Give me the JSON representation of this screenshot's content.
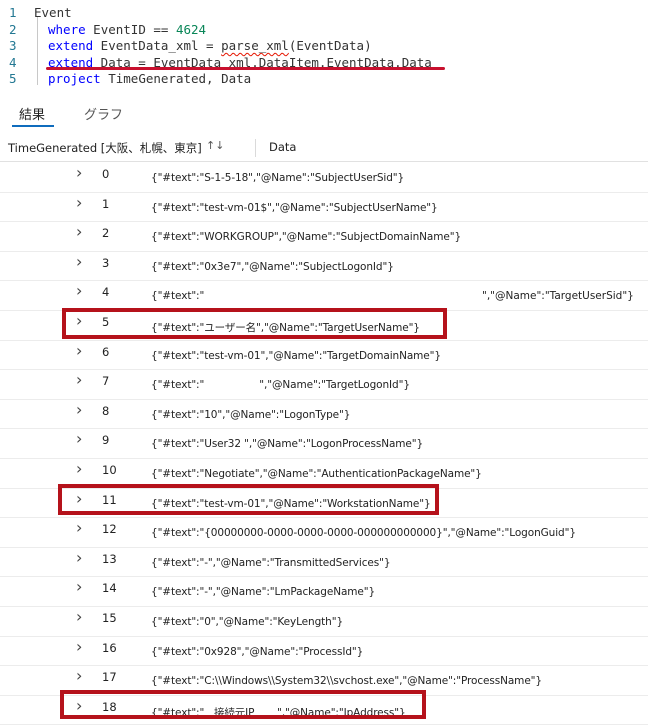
{
  "editor": {
    "lines": [
      {
        "num": "1",
        "parts": [
          {
            "t": "Event",
            "c": "plain"
          }
        ]
      },
      {
        "num": "2",
        "parts": [
          {
            "t": "where",
            "c": "kw"
          },
          {
            "t": " EventID == ",
            "c": "plain"
          },
          {
            "t": "4624",
            "c": "num"
          }
        ]
      },
      {
        "num": "3",
        "parts": [
          {
            "t": "extend",
            "c": "kw"
          },
          {
            "t": " EventData_xml = ",
            "c": "plain"
          },
          {
            "t": "parse_xml",
            "c": "plain squiggle"
          },
          {
            "t": "(EventData)",
            "c": "plain"
          }
        ]
      },
      {
        "num": "4",
        "parts": [
          {
            "t": "extend",
            "c": "kw"
          },
          {
            "t": " Data = EventData_xml.DataItem.EventData.Data",
            "c": "plain"
          }
        ]
      },
      {
        "num": "5",
        "parts": [
          {
            "t": "project",
            "c": "kw"
          },
          {
            "t": " TimeGenerated, Data",
            "c": "plain"
          }
        ]
      }
    ]
  },
  "tabs": {
    "results": "結果",
    "graph": "グラフ"
  },
  "table": {
    "col_time": "TimeGenerated [大阪、札幌、東京]",
    "sort_icon": "↑↓",
    "col_data": "Data",
    "rows": [
      {
        "index": "0",
        "text": "{\"#text\":\"S-1-5-18\",\"@Name\":\"SubjectUserSid\"}",
        "right": ""
      },
      {
        "index": "1",
        "text": "{\"#text\":\"test-vm-01$\",\"@Name\":\"SubjectUserName\"}",
        "right": ""
      },
      {
        "index": "2",
        "text": "{\"#text\":\"WORKGROUP\",\"@Name\":\"SubjectDomainName\"}",
        "right": ""
      },
      {
        "index": "3",
        "text": "{\"#text\":\"0x3e7\",\"@Name\":\"SubjectLogonId\"}",
        "right": ""
      },
      {
        "index": "4",
        "text": "{\"#text\":\"",
        "right": "\",\"@Name\":\"TargetUserSid\"}"
      },
      {
        "index": "5",
        "text": "{\"#text\":\"ユーザー名\",\"@Name\":\"TargetUserName\"}",
        "right": ""
      },
      {
        "index": "6",
        "text": "{\"#text\":\"test-vm-01\",\"@Name\":\"TargetDomainName\"}",
        "right": ""
      },
      {
        "index": "7",
        "text": "{\"#text\":\"                 \",\"@Name\":\"TargetLogonId\"}",
        "right": ""
      },
      {
        "index": "8",
        "text": "{\"#text\":\"10\",\"@Name\":\"LogonType\"}",
        "right": ""
      },
      {
        "index": "9",
        "text": "{\"#text\":\"User32 \",\"@Name\":\"LogonProcessName\"}",
        "right": ""
      },
      {
        "index": "10",
        "text": "{\"#text\":\"Negotiate\",\"@Name\":\"AuthenticationPackageName\"}",
        "right": ""
      },
      {
        "index": "11",
        "text": "{\"#text\":\"test-vm-01\",\"@Name\":\"WorkstationName\"}",
        "right": ""
      },
      {
        "index": "12",
        "text": "{\"#text\":\"{00000000-0000-0000-0000-000000000000}\",\"@Name\":\"LogonGuid\"}",
        "right": ""
      },
      {
        "index": "13",
        "text": "{\"#text\":\"-\",\"@Name\":\"TransmittedServices\"}",
        "right": ""
      },
      {
        "index": "14",
        "text": "{\"#text\":\"-\",\"@Name\":\"LmPackageName\"}",
        "right": ""
      },
      {
        "index": "15",
        "text": "{\"#text\":\"0\",\"@Name\":\"KeyLength\"}",
        "right": ""
      },
      {
        "index": "16",
        "text": "{\"#text\":\"0x928\",\"@Name\":\"ProcessId\"}",
        "right": ""
      },
      {
        "index": "17",
        "text": "{\"#text\":\"C:\\\\Windows\\\\System32\\\\svchost.exe\",\"@Name\":\"ProcessName\"}",
        "right": ""
      },
      {
        "index": "18",
        "text": "{\"#text\":\"   接続元IP       \",\"@Name\":\"IpAddress\"}",
        "right": ""
      }
    ]
  },
  "colors": {
    "keyword": "#0000ff",
    "number": "#098658",
    "highlight_box": "#b5121b",
    "active_tab": "#0f6cbd"
  }
}
